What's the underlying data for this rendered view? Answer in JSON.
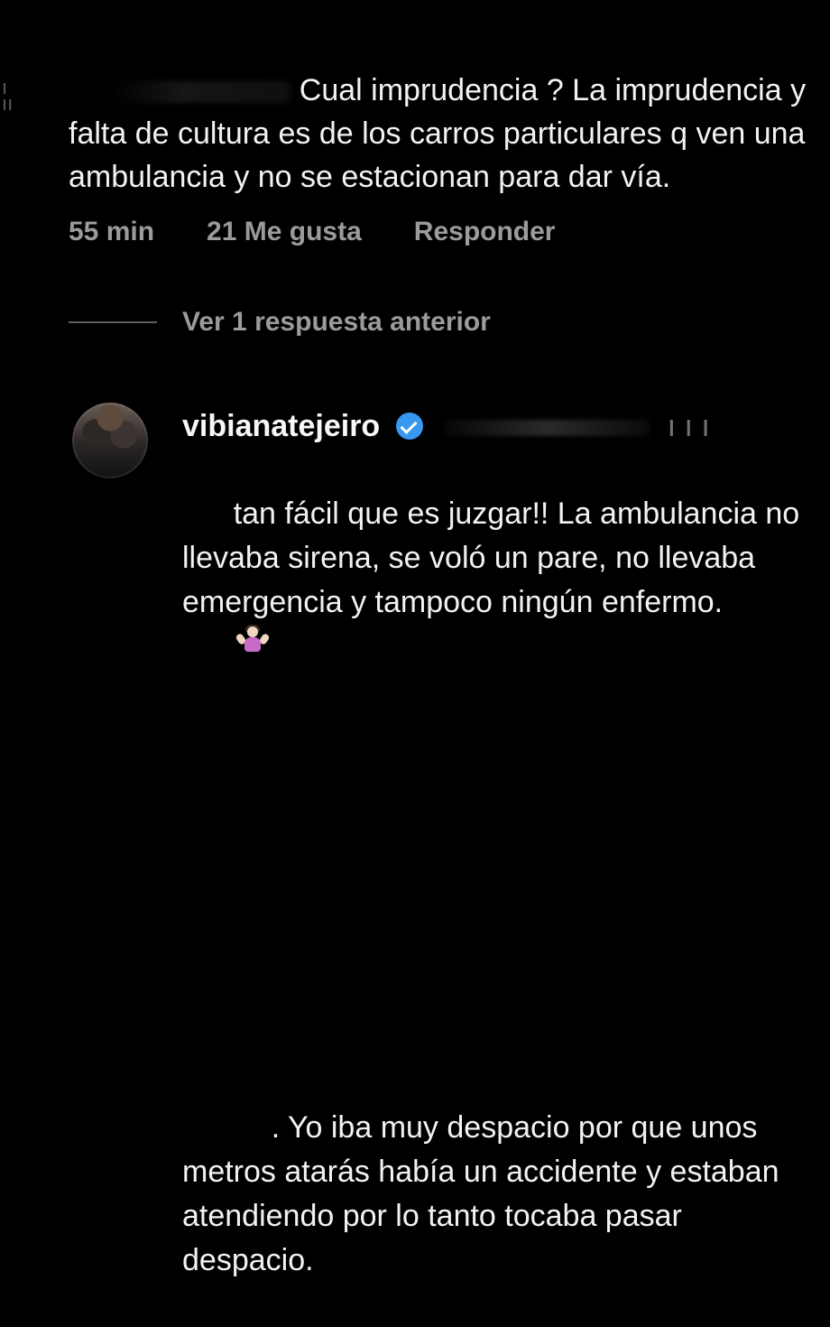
{
  "comment": {
    "text": "Cual imprudencia ? La imprudencia y falta de cultura es de los carros particulares q ven una ambulancia y no se estacionan para dar vía.",
    "meta": {
      "time": "55 min",
      "likes": "21 Me gusta",
      "reply": "Responder"
    },
    "view_previous": "Ver 1 respuesta anterior",
    "left_fragment": "ı ıı"
  },
  "reply": {
    "username": "vibianatejeiro",
    "text_start": "tan fácil que es juzgar!! La ambulancia no llevaba sirena, se voló un pare, no llevaba emergencia y tampoco ningún enfermo.",
    "text_end": ". Yo iba muy despacio por que unos metros atarás había un accidente y estaban atendiendo por lo tanto tocaba pasar despacio.",
    "mention_fragment": "ı ı ı",
    "badge_icon": "verified-badge-icon",
    "emoji_icon": "woman-shrugging-emoji-icon"
  },
  "colors": {
    "background": "#000000",
    "text": "#f2f2f2",
    "muted": "#9b9b9b",
    "verified": "#3897f0"
  }
}
